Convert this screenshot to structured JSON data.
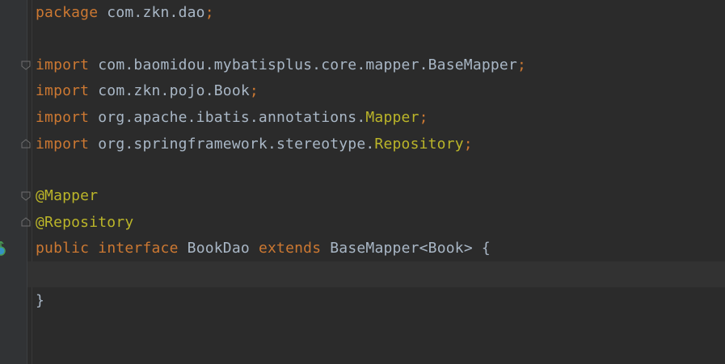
{
  "colors": {
    "background": "#2b2b2b",
    "gutter": "#313335",
    "keyword": "#cc7832",
    "annotation": "#bbb529",
    "identifier": "#a9b7c6",
    "current_line": "#323232"
  },
  "code": {
    "line1": {
      "kw": "package",
      "rest": " com.zkn.dao",
      "semi": ";"
    },
    "line3": {
      "kw": "import",
      "rest": " com.baomidou.mybatisplus.core.mapper.BaseMapper",
      "semi": ";"
    },
    "line4": {
      "kw": "import",
      "rest": " com.zkn.pojo.Book",
      "semi": ";"
    },
    "line5": {
      "kw": "import",
      "rest": " org.apache.ibatis.annotations.",
      "ann": "Mapper",
      "semi": ";"
    },
    "line6": {
      "kw": "import",
      "rest": " org.springframework.stereotype.",
      "ann": "Repository",
      "semi": ";"
    },
    "line8": {
      "ann": "@Mapper"
    },
    "line9": {
      "ann": "@Repository"
    },
    "line10": {
      "kw1": "public",
      "kw2": "interface",
      "name": " BookDao ",
      "kw3": "extends",
      "rest": " BaseMapper<Book> {"
    },
    "line12": {
      "text": "}"
    }
  },
  "gutter_icons": {
    "fold_marker": "fold-marker-icon",
    "implementation": "implemented-interface-icon"
  }
}
